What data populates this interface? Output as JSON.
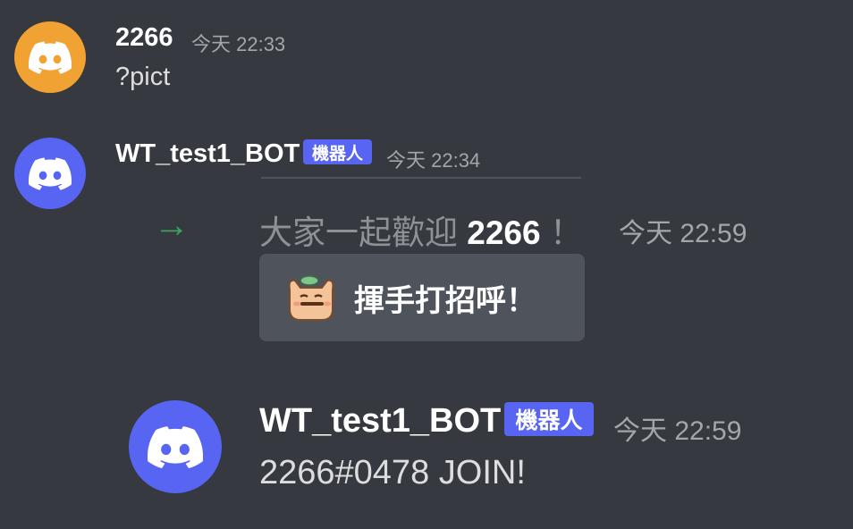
{
  "messages": [
    {
      "username": "2266",
      "timestamp": "今天 22:33",
      "content": "?pict",
      "avatar_icon": "discord-logo-icon",
      "avatar_color": "#f0a232"
    },
    {
      "username": "WT_test1_BOT",
      "bot_tag": "機器人",
      "timestamp": "今天 22:34",
      "avatar_icon": "discord-logo-icon",
      "avatar_color": "#5865f2"
    }
  ],
  "system_join": {
    "arrow_icon": "join-arrow-icon",
    "prefix": "大家一起歡迎",
    "member": "2266",
    "suffix": "！",
    "timestamp": "今天 22:59",
    "wave_button_label": "揮手打招呼！",
    "wave_sticker_icon": "wave-sticker-icon"
  },
  "bot_message": {
    "username": "WT_test1_BOT",
    "bot_tag": "機器人",
    "timestamp": "今天 22:59",
    "content": "2266#0478 JOIN!",
    "avatar_icon": "discord-logo-icon",
    "avatar_color": "#5865f2"
  },
  "colors": {
    "background": "#36393f",
    "blurple": "#5865f2",
    "join_green": "#3ba55d",
    "button_bg": "#4f545c"
  }
}
